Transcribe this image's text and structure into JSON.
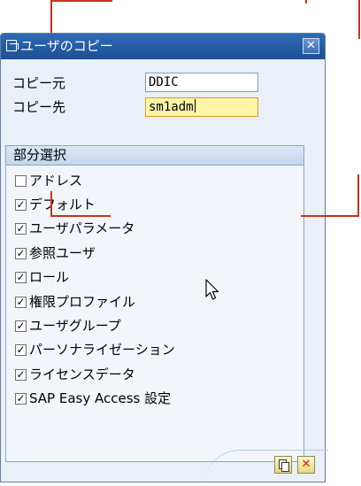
{
  "dialog": {
    "title": "ユーザのコピー",
    "close_glyph": "✕"
  },
  "form": {
    "source_label": "コピー元",
    "source_value": "DDIC",
    "target_label": "コピー先",
    "target_value": "sm1adm"
  },
  "partial_selection": {
    "header": "部分選択",
    "items": [
      {
        "label": "アドレス",
        "checked": false
      },
      {
        "label": "デフォルト",
        "checked": true
      },
      {
        "label": "ユーザパラメータ",
        "checked": true
      },
      {
        "label": "参照ユーザ",
        "checked": true
      },
      {
        "label": "ロール",
        "checked": true
      },
      {
        "label": "権限プロファイル",
        "checked": true
      },
      {
        "label": "ユーザグループ",
        "checked": true
      },
      {
        "label": "パーソナライゼーション",
        "checked": true
      },
      {
        "label": "ライセンスデータ",
        "checked": true
      },
      {
        "label": "SAP Easy Access 設定",
        "checked": true
      }
    ]
  },
  "buttons": {
    "copy_icon": "copy-icon",
    "cancel_glyph": "✕"
  },
  "colors": {
    "title_bar": "#1e4f93",
    "annotation": "#c8321e",
    "active_field": "#fff4a8"
  }
}
